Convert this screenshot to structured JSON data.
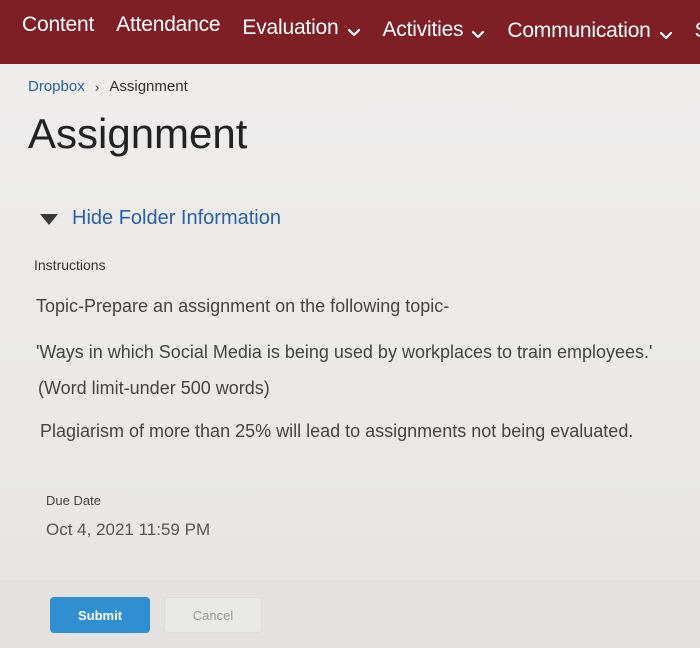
{
  "nav": {
    "items": [
      {
        "label": "Content",
        "dropdown": false
      },
      {
        "label": "Attendance",
        "dropdown": false
      },
      {
        "label": "Evaluation",
        "dropdown": true
      },
      {
        "label": "Activities",
        "dropdown": true
      },
      {
        "label": "Communication",
        "dropdown": true
      },
      {
        "label": "S",
        "dropdown": false
      }
    ],
    "bg_color": "#7e1f26"
  },
  "breadcrumb": {
    "parent": "Dropbox",
    "current": "Assignment"
  },
  "page_title": "Assignment",
  "folder_toggle": {
    "label": "Hide Folder Information",
    "icon": "triangle-down-icon"
  },
  "instructions": {
    "heading": "Instructions",
    "lines": [
      "Topic-Prepare an assignment on the following topic-",
      "'Ways in which Social Media is being used by workplaces to train employees.'",
      "(Word limit-under 500 words)",
      "Plagiarism of more than 25% will lead to assignments not being evaluated."
    ]
  },
  "due_date": {
    "heading": "Due Date",
    "value": "Oct 4, 2021 11:59 PM"
  },
  "actions": {
    "submit_label": "Submit",
    "cancel_label": "Cancel",
    "submit_color": "#2f8fd0"
  }
}
